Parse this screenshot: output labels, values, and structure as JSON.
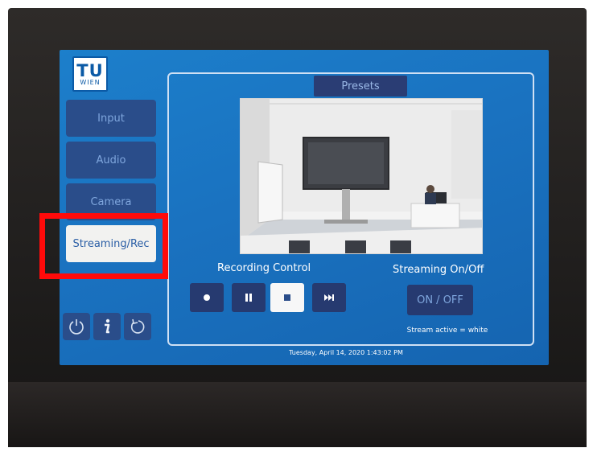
{
  "brand": {
    "logo_line1": "TU",
    "logo_line2": "WIEN",
    "accent_color": "#1a72c0",
    "highlight_color": "#ff0a0a"
  },
  "sidebar": {
    "items": [
      {
        "label": "Input",
        "active": false
      },
      {
        "label": "Audio",
        "active": false
      },
      {
        "label": "Camera",
        "active": false
      },
      {
        "label": "Streaming/Rec",
        "active": true
      }
    ],
    "utility_icons": [
      "power-icon",
      "info-icon",
      "undo-icon"
    ]
  },
  "main": {
    "presets_label": "Presets",
    "recording": {
      "title": "Recording Control",
      "buttons": [
        "record-icon",
        "pause-icon",
        "stop-icon",
        "skip-icon"
      ]
    },
    "streaming": {
      "title": "Streaming On/Off",
      "toggle_label": "ON / OFF",
      "hint": "Stream active = white"
    },
    "datetime": "Tuesday, April 14, 2020 1:43:02 PM"
  }
}
